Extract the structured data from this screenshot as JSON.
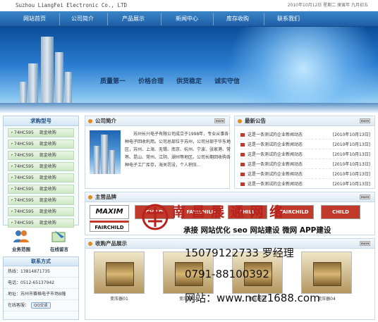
{
  "header": {
    "logo_text": "Suzhou LiangFei Electronic Co., LTD",
    "date_text": "2010年10月12日  星期二  庚寅年 九月初五"
  },
  "nav": {
    "items": [
      "网站首页",
      "公司简介",
      "产品展示",
      "新闻中心",
      "库存收购",
      "联系我们"
    ]
  },
  "banner": {
    "slogans": [
      "质量第一",
      "价格合理",
      "供货稳定",
      "诚实守信"
    ]
  },
  "sidebar": {
    "title": "求购型号",
    "items": [
      {
        "model": "74HC595",
        "action": "现金收购"
      },
      {
        "model": "74HC595",
        "action": "现金收购"
      },
      {
        "model": "74HC595",
        "action": "现金收购"
      },
      {
        "model": "74HC595",
        "action": "现金收购"
      },
      {
        "model": "74HC595",
        "action": "现金收购"
      },
      {
        "model": "74HC595",
        "action": "现金收购"
      },
      {
        "model": "74HC595",
        "action": "现金收购"
      },
      {
        "model": "74HC595",
        "action": "现金收购"
      },
      {
        "model": "74HC595",
        "action": "现金收购"
      }
    ]
  },
  "quick": {
    "scope_label": "业务范围",
    "message_label": "在线留言"
  },
  "contact": {
    "title": "联系方式",
    "hotline": "热线：13814871735",
    "phone": "电话：0512-65137942",
    "address": "地址：苏州市赛格电子市场B幢",
    "online_label": "在线客服：",
    "qq_label": "QQ交谈"
  },
  "intro": {
    "title": "公司简介",
    "more": "more",
    "text": "苏州长兴电子有限公司成立于1998年，专业从事各种电子回收利用。公司总部位于苏州，公司分部于华东地区，苏州、上海、无锡、南京、杭州、宁波、张家港、常熟、昆山、常州、江阴、湖州等地区。公司长期回收购各种电子工厂库存，海关罚没，个人积压..."
  },
  "notice": {
    "title": "最新公告",
    "more": "more",
    "items": [
      {
        "text": "这是一条测试的企业新闻动态",
        "date": "[2010年10月13日]"
      },
      {
        "text": "这是一条测试的企业新闻动态",
        "date": "[2010年10月13日]"
      },
      {
        "text": "这是一条测试的企业新闻动态",
        "date": "[2010年10月13日]"
      },
      {
        "text": "这是一条测试的企业新闻动态",
        "date": "[2010年10月13日]"
      },
      {
        "text": "这是一条测试的企业新闻动态",
        "date": "[2010年10月13日]"
      },
      {
        "text": "这是一条测试的企业新闻动态",
        "date": "[2010年10月13日]"
      }
    ]
  },
  "brands": {
    "title": "主营品牌",
    "more": "more",
    "names": [
      "MAXIM",
      "FAIRCHILD",
      "CHILD"
    ]
  },
  "products": {
    "title": "收购产品展示",
    "more": "more",
    "captions": [
      "变压器01",
      "变压器02",
      "变压器03",
      "变压器04"
    ]
  },
  "watermark": {
    "line1": "南 昌 展 通 网 络",
    "line2": "承接 网站优化 seo 网站建设 微网 APP建设",
    "line3": "15079122733  罗经理",
    "line4": "0791-88100392",
    "line5": "网站：www.nctz1688.com"
  }
}
